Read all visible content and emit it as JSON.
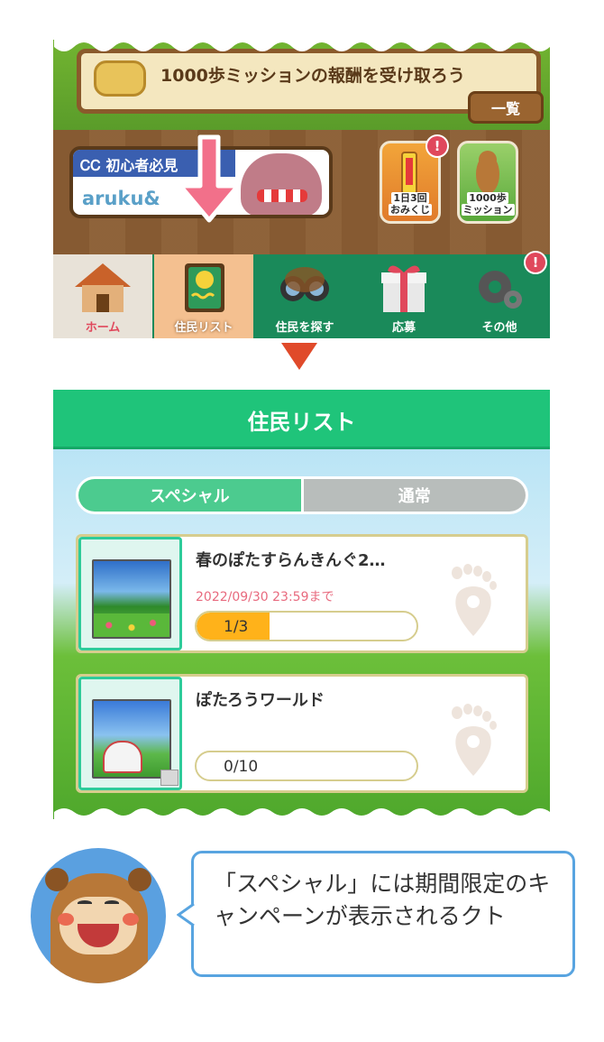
{
  "top_panel": {
    "mission_text": "1000歩ミッションの報酬を受け取ろう",
    "list_button": "一覧",
    "banner": {
      "heading": "初心者必見",
      "logo": "aruku&"
    },
    "features": [
      {
        "label_line1": "1日3回",
        "label_line2": "おみくじ",
        "badge": "!"
      },
      {
        "label_line1": "1000歩",
        "label_line2": "ミッション",
        "badge": ""
      }
    ],
    "tabs": [
      {
        "label": "ホーム"
      },
      {
        "label": "住民リスト"
      },
      {
        "label": "住民を探す"
      },
      {
        "label": "応募"
      },
      {
        "label": "その他",
        "badge": "!"
      }
    ]
  },
  "resident_list": {
    "title": "住民リスト",
    "segments": {
      "special": "スペシャル",
      "normal": "通常",
      "selected": "スペシャル"
    },
    "cards": [
      {
        "title": "春のぽたすらんきんぐ2…",
        "deadline": "2022/09/30 23:59まで",
        "progress_text": "1/3",
        "progress": 0.333
      },
      {
        "title": "ぽたろうワールド",
        "deadline": "",
        "progress_text": "0/10",
        "progress": 0
      }
    ]
  },
  "speech": {
    "text": "「スペシャル」には期間限定のキャンペーンが表示されるクト"
  },
  "colors": {
    "accent_green": "#1fc47a",
    "pointer_pink": "#f2708a",
    "arrow_red": "#e04a2a",
    "progress_orange": "#ffb21a",
    "bubble_border": "#58a4e0"
  },
  "icons": [
    "home-icon",
    "resident-list-icon",
    "binoculars-icon",
    "gift-icon",
    "gear-icon",
    "footprint-pin-icon",
    "down-arrow-icon"
  ]
}
